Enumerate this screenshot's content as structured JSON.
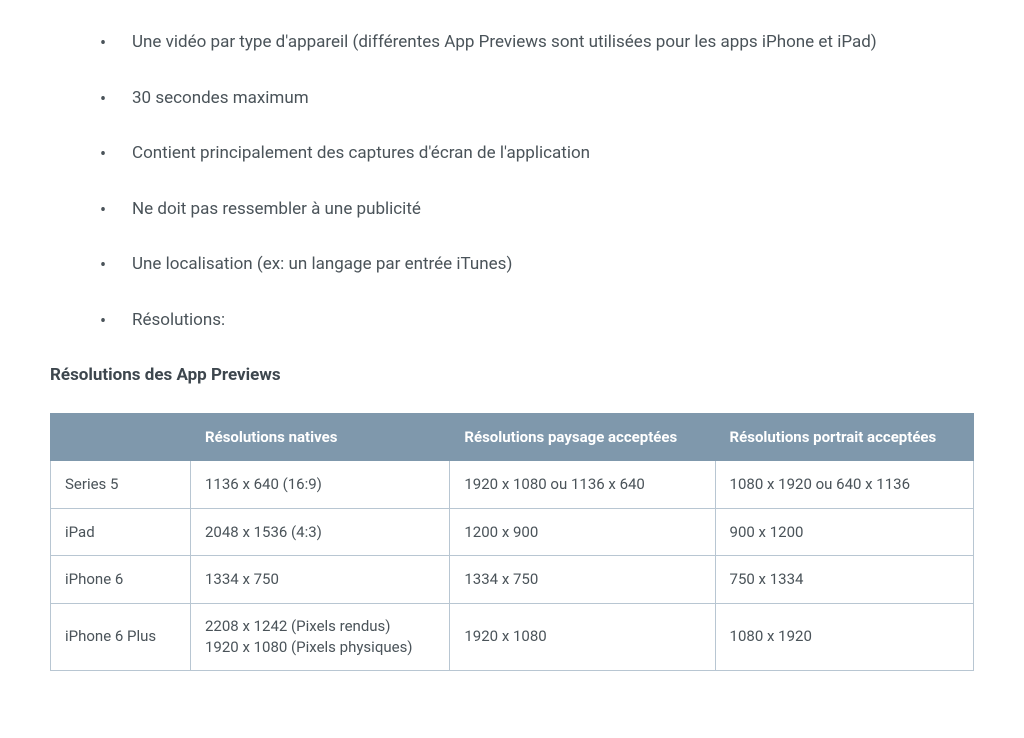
{
  "bullets": [
    "Une vidéo par type d'appareil (différentes App Previews sont utilisées pour les apps iPhone et iPad)",
    "30 secondes maximum",
    "Contient principalement des captures d'écran de l'application",
    "Ne doit pas ressembler à une publicité",
    "Une localisation (ex: un langage par entrée iTunes)",
    "Résolutions:"
  ],
  "heading": "Résolutions des App Previews",
  "chart_data": {
    "type": "table",
    "columns": [
      "",
      "Résolutions natives",
      "Résolutions paysage acceptées",
      "Résolutions portrait acceptées"
    ],
    "rows": [
      {
        "device": "Series 5",
        "native": "1136 x 640 (16:9)",
        "landscape": "1920 x 1080 ou 1136 x 640",
        "portrait": "1080 x 1920 ou 640 x 1136"
      },
      {
        "device": "iPad",
        "native": "2048 x 1536 (4:3)",
        "landscape": "1200 x 900",
        "portrait": "900 x 1200"
      },
      {
        "device": "iPhone 6",
        "native": "1334 x 750",
        "landscape": "1334 x 750",
        "portrait": "750 x 1334"
      },
      {
        "device": "iPhone 6 Plus",
        "native": "2208 x 1242 (Pixels rendus)\n1920 x 1080 (Pixels physiques)",
        "landscape": "1920 x 1080",
        "portrait": "1080 x 1920"
      }
    ]
  }
}
